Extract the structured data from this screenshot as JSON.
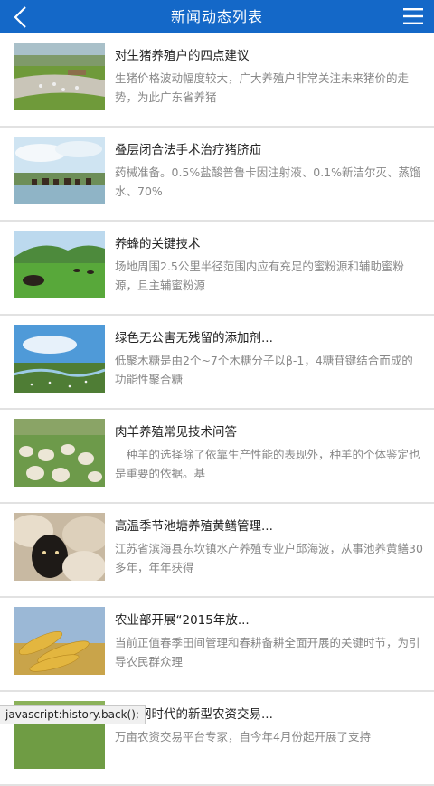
{
  "header": {
    "title": "新闻动态列表",
    "back_icon": "chevron-left-icon",
    "menu_icon": "hamburger-menu-icon",
    "color": "#1468c8"
  },
  "news": [
    {
      "title": "对生猪养殖户的四点建议",
      "desc": "生猪价格波动幅度较大，广大养殖户非常关注未来猪价的走势，为此广东省养猪"
    },
    {
      "title": "叠层闭合法手术治疗猪脐疝",
      "desc": "药械准备。0.5%盐酸普鲁卡因注射液、0.1%新洁尔灭、蒸馏水、70%"
    },
    {
      "title": "养蜂的关键技术",
      "desc": "场地周围2.5公里半径范围内应有充足的蜜粉源和辅助蜜粉源，且主辅蜜粉源"
    },
    {
      "title": "绿色无公害无残留的添加剂...",
      "desc": "低聚木糖是由2个~7个木糖分子以β-1，4糖苷键结合而成的功能性聚合糖"
    },
    {
      "title": "肉羊养殖常见技术问答",
      "desc": "　种羊的选择除了依靠生产性能的表现外，种羊的个体鉴定也是重要的依据。基"
    },
    {
      "title": "高温季节池塘养殖黄鳝管理...",
      "desc": "江苏省滨海县东坎镇水产养殖专业户邱海波，从事池养黄鳝30多年，年年获得"
    },
    {
      "title": "农业部开展“2015年放...",
      "desc": "当前正值春季田间管理和春耕备耕全面开展的关键时节，为引导农民群众理"
    },
    {
      "title": "互联网时代的新型农资交易...",
      "desc": "万亩农资交易平台专家，自今年4月份起开展了支持"
    }
  ],
  "status_bar": "javascript:history.back();"
}
